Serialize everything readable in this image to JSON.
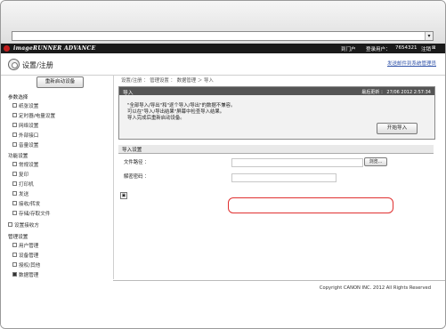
{
  "browser": {
    "dropdown_arrow": "▾"
  },
  "brand": {
    "name": "imageRUNNER ADVANCE"
  },
  "topbar": {
    "portal": "到门户",
    "login_user_label": "登录用户：",
    "login_user": "7654321",
    "logout": "注销",
    "logout_glyph": "⊠"
  },
  "header": {
    "title": "设置/注册",
    "email_link": "发送邮件到系统管理员"
  },
  "sidebar": {
    "restart_button": "重新启动设备",
    "sections": [
      {
        "title": "参数选择",
        "items": [
          "纸张设置",
          "定时器/电量设置",
          "网络设置",
          "外部接口",
          "音量设置"
        ]
      },
      {
        "title": "功能设置",
        "items": [
          "常规设置",
          "复印",
          "打印机",
          "发送",
          "接收/转发",
          "存储/存取文件"
        ]
      },
      {
        "title": "设置接收方",
        "items": []
      },
      {
        "title": "管理设置",
        "items": [
          "用户管理",
          "设备管理",
          "授权/其他",
          "数据管理"
        ]
      }
    ]
  },
  "breadcrumb": "设置/注册 ： 管理设置 ： 数据管理 ＞ 导入",
  "import_panel": {
    "title": "导入",
    "last_updated": "最后更新 ： 27/06 2012 2:57:34",
    "messages": [
      "\"全部导入/导出\"和\"逐个导入/导出\"的数据不兼容。",
      "可以在\"导入/导出结果\"屏幕中检查导入结果。",
      "导入完成后重新启动设备。"
    ],
    "start_button": "开始导入"
  },
  "import_settings": {
    "title": "导入设置",
    "file_path_label": "文件路径 ：",
    "file_path_value": "",
    "browse_button": "浏览...",
    "decrypt_label": "解密密码 ：",
    "decrypt_value": ""
  },
  "footer": {
    "mini_icon": "▣",
    "copyright": "Copyright CANON INC. 2012 All Rights Reserved"
  }
}
